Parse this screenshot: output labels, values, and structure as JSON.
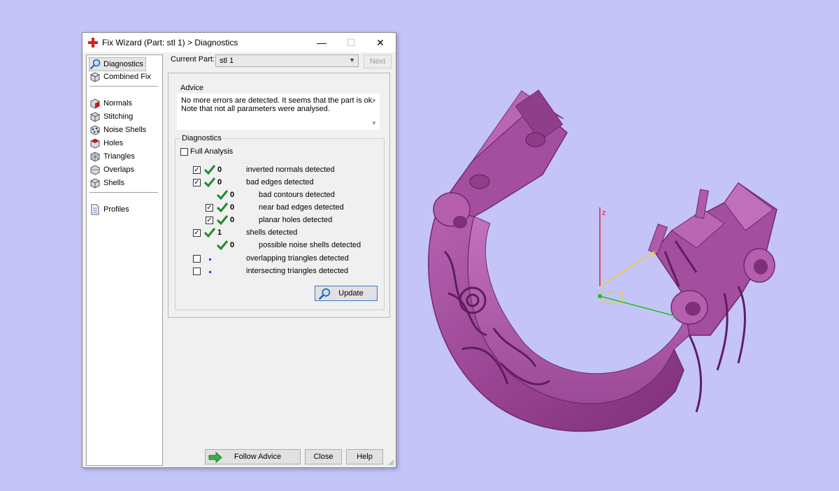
{
  "dialog": {
    "title": "Fix Wizard (Part: stl 1) > Diagnostics",
    "minimize": "—",
    "maximize": "☐",
    "close": "✕"
  },
  "nav": {
    "items": [
      {
        "label": "Diagnostics",
        "icon": "magnifier-icon"
      },
      {
        "label": "Combined Fix",
        "icon": "cube-icon"
      },
      {
        "label": "Normals",
        "icon": "normals-cube-icon"
      },
      {
        "label": "Stitching",
        "icon": "stitching-cube-icon"
      },
      {
        "label": "Noise Shells",
        "icon": "noise-shells-icon"
      },
      {
        "label": "Holes",
        "icon": "holes-cube-icon"
      },
      {
        "label": "Triangles",
        "icon": "triangles-icon"
      },
      {
        "label": "Overlaps",
        "icon": "overlaps-icon"
      },
      {
        "label": "Shells",
        "icon": "shells-icon"
      },
      {
        "label": "Profiles",
        "icon": "document-icon"
      }
    ]
  },
  "part": {
    "label": "Current Part:",
    "value": "stl 1",
    "next_label": "Next"
  },
  "advice": {
    "title": "Advice",
    "line1": "No more errors are detected. It seems that the part is ok.",
    "line2": "Note that not all parameters were analysed."
  },
  "diagnostics": {
    "title": "Diagnostics",
    "full_analysis": "Full Analysis",
    "rows": [
      {
        "count": "0",
        "text": "inverted normals detected"
      },
      {
        "count": "0",
        "text": "bad edges detected"
      },
      {
        "count": "0",
        "text": "bad contours detected"
      },
      {
        "count": "0",
        "text": "near bad edges detected"
      },
      {
        "count": "0",
        "text": "planar holes detected"
      },
      {
        "count": "1",
        "text": "shells detected"
      },
      {
        "count": "0",
        "text": "possible noise shells detected"
      },
      {
        "count": "",
        "text": "overlapping triangles detected"
      },
      {
        "count": "",
        "text": "intersecting triangles detected"
      }
    ],
    "update_label": "Update"
  },
  "footer": {
    "follow_advice": "Follow Advice",
    "close": "Close",
    "help": "Help"
  },
  "viewport": {
    "axis_z": "z",
    "axis_y": "y",
    "axis_x": "x",
    "model_color": "#a44ea0",
    "background": "#c4c4f8"
  }
}
